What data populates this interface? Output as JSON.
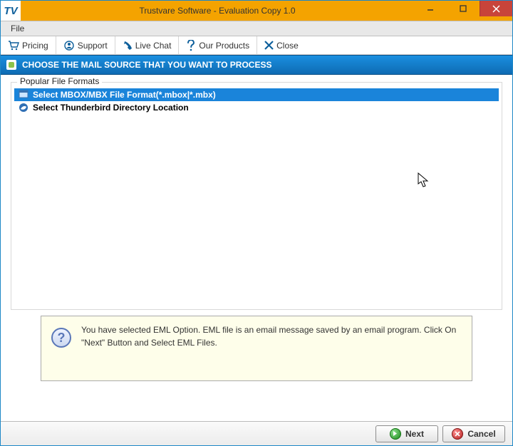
{
  "window": {
    "title": "Trustvare Software - Evaluation Copy 1.0",
    "logo_text": "TV"
  },
  "menubar": {
    "file": "File"
  },
  "toolbar": {
    "pricing": "Pricing",
    "support": "Support",
    "livechat": "Live Chat",
    "products": "Our Products",
    "close": "Close"
  },
  "header": {
    "text": "CHOOSE THE MAIL SOURCE THAT YOU WANT TO PROCESS"
  },
  "group": {
    "legend": "Popular File Formats",
    "items": [
      {
        "label": "Select MBOX/MBX File Format(*.mbox|*.mbx)",
        "selected": true,
        "icon": "file"
      },
      {
        "label": "Select Thunderbird Directory Location",
        "selected": false,
        "icon": "thunderbird"
      }
    ]
  },
  "info": {
    "text": "You have selected EML Option. EML file is an email message saved by an email program. Click On \"Next\" Button and Select EML Files."
  },
  "footer": {
    "next": "Next",
    "cancel": "Cancel"
  }
}
